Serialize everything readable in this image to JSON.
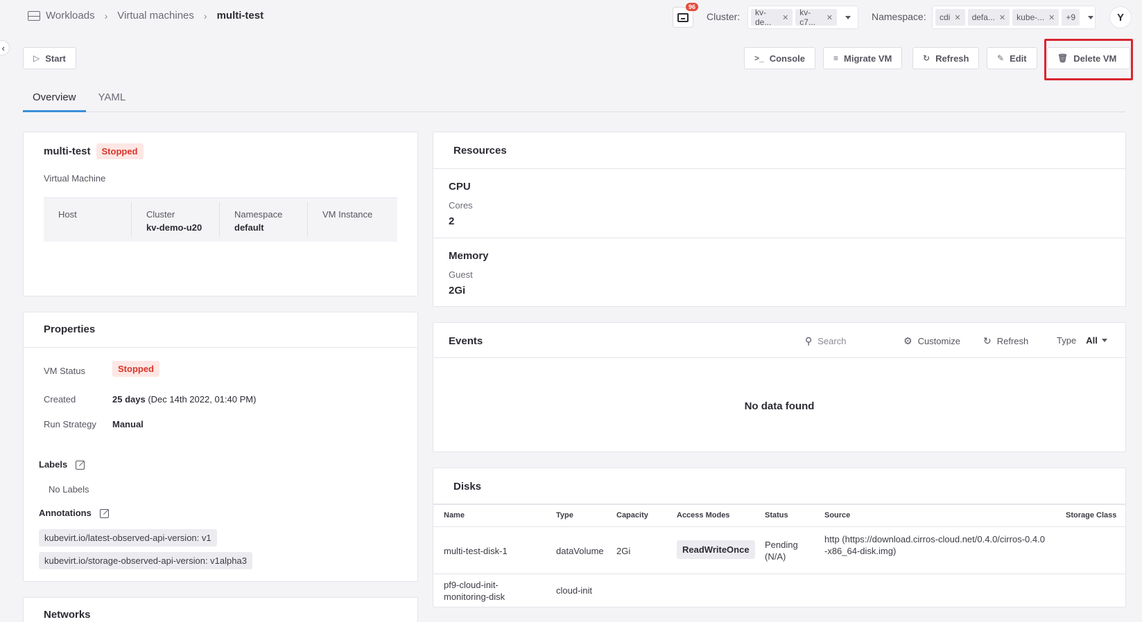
{
  "breadcrumb": {
    "items": [
      "Workloads",
      "Virtual machines"
    ],
    "current": "multi-test"
  },
  "notifications": {
    "count": "96"
  },
  "filters": {
    "cluster_label": "Cluster:",
    "cluster_chips": [
      "kv-de...",
      "kv-c7..."
    ],
    "namespace_label": "Namespace:",
    "namespace_chips": [
      "cdi",
      "defa...",
      "kube-..."
    ],
    "namespace_more": "+9"
  },
  "user": {
    "initial": "Y"
  },
  "actions": {
    "start": "Start",
    "console": "Console",
    "migrate": "Migrate VM",
    "refresh": "Refresh",
    "edit": "Edit",
    "delete": "Delete VM"
  },
  "tabs": [
    "Overview",
    "YAML"
  ],
  "summary": {
    "name": "multi-test",
    "status": "Stopped",
    "kind": "Virtual Machine",
    "host_label": "Host",
    "cluster_label": "Cluster",
    "cluster_value": "kv-demo-u20",
    "namespace_label": "Namespace",
    "namespace_value": "default",
    "vmi_label": "VM Instance"
  },
  "properties": {
    "title": "Properties",
    "status_label": "VM Status",
    "status_value": "Stopped",
    "created_label": "Created",
    "created_value": "25 days",
    "created_detail": "(Dec 14th 2022, 01:40 PM)",
    "run_label": "Run Strategy",
    "run_value": "Manual",
    "labels_title": "Labels",
    "no_labels": "No Labels",
    "annotations_title": "Annotations",
    "annotations": [
      "kubevirt.io/latest-observed-api-version: v1",
      "kubevirt.io/storage-observed-api-version: v1alpha3"
    ]
  },
  "networks": {
    "title": "Networks"
  },
  "resources": {
    "title": "Resources",
    "cpu_label": "CPU",
    "cores_label": "Cores",
    "cores_value": "2",
    "memory_label": "Memory",
    "guest_label": "Guest",
    "guest_value": "2Gi"
  },
  "events": {
    "title": "Events",
    "search_placeholder": "Search",
    "customize": "Customize",
    "refresh": "Refresh",
    "type_label": "Type",
    "type_value": "All",
    "empty": "No data found"
  },
  "disks": {
    "title": "Disks",
    "columns": [
      "Name",
      "Type",
      "Capacity",
      "Access Modes",
      "Status",
      "Source",
      "Storage Class"
    ],
    "rows": [
      {
        "name": "multi-test-disk-1",
        "type": "dataVolume",
        "capacity": "2Gi",
        "access": "ReadWriteOnce",
        "status": "Pending (N/A)",
        "source": "http (https://download.cirros-cloud.net/0.4.0/cirros-0.4.0-x86_64-disk.img)"
      },
      {
        "name": "pf9-cloud-init-monitoring-disk",
        "type": "cloud-init",
        "capacity": "",
        "access": "",
        "status": "",
        "source": ""
      }
    ]
  },
  "colors": {
    "accent": "#3b8fd8",
    "danger": "#d9362b",
    "highlight": "#d8262f"
  }
}
